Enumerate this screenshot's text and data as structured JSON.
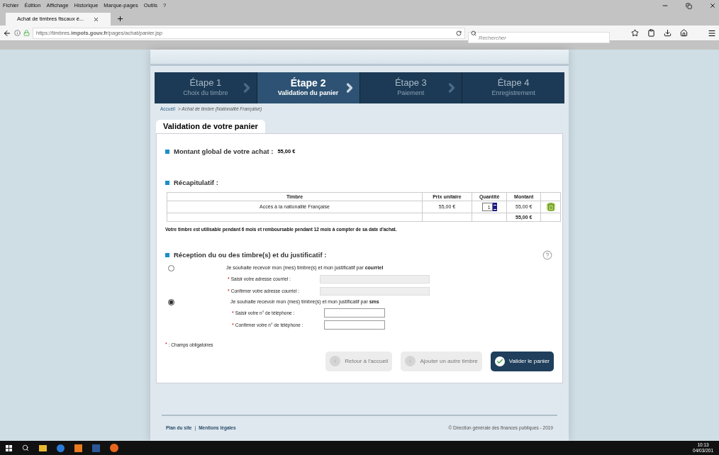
{
  "browser": {
    "menu": [
      "Fichier",
      "Édition",
      "Affichage",
      "Historique",
      "Marque-pages",
      "Outils",
      "?"
    ],
    "tab": {
      "title": "Achat de timbres fiscaux é..."
    },
    "url": "https://timbres.**impots.gouv.fr**/pages/achat/panier.jsp",
    "search": {
      "placeholder": "Rechercher"
    }
  },
  "steps": [
    {
      "title": "Étape 1",
      "subtitle": "Choix du timbre",
      "selected": false
    },
    {
      "title": "Étape 2",
      "subtitle": "Validation du panier",
      "selected": true
    },
    {
      "title": "Étape 3",
      "subtitle": "Paiement",
      "selected": false
    },
    {
      "title": "Étape 4",
      "subtitle": "Enregistrement",
      "selected": false
    }
  ],
  "breadcrumb": {
    "link": "Accueil",
    "rest": "> Achat de timbre (Nationalité Française)"
  },
  "card": {
    "title": "Validation de votre panier"
  },
  "total": {
    "label": "Montant global de votre achat :",
    "value": "55,00 €"
  },
  "recap": {
    "heading": "Récapitulatif :",
    "columns": [
      "Timbre",
      "Prix unitaire",
      "Quantité",
      "Montant"
    ],
    "rows": [
      {
        "timbre": "Accès à la nationalité Française",
        "prix": "55,00 €",
        "quantite": "1",
        "montant": "55,00 €"
      }
    ],
    "sum": "55,00 €",
    "note": "Votre timbre est utilisable pendant 6 mois et remboursable pendant 12 mois à compter de sa date d'achat."
  },
  "reception": {
    "heading": "Réception du ou des timbre(s) et du justificatif :",
    "options": [
      {
        "label": "Je souhaite recevoir mon (mes) timbre(s) et mon justificatif par **courriel**",
        "selected": false,
        "fields": [
          {
            "label": "Saisir votre adresse courriel :",
            "disabled": true
          },
          {
            "label": "Confirmer votre adresse courriel :",
            "disabled": true
          }
        ]
      },
      {
        "label": "Je souhaite recevoir mon (mes) timbre(s) et mon justificatif par **sms**",
        "selected": true,
        "fields": [
          {
            "label": "Saisir votre n° de téléphone :",
            "disabled": false
          },
          {
            "label": "Confirmer votre n° de téléphone :",
            "disabled": false
          }
        ]
      }
    ]
  },
  "required": {
    "mark": "*",
    "label": ": Champs obligatoires"
  },
  "buttons": [
    {
      "label": "Retour à l'accueil",
      "kind": "secondary"
    },
    {
      "label": "Ajouter un autre timbre",
      "kind": "secondary"
    },
    {
      "label": "Valider le panier",
      "kind": "primary"
    }
  ],
  "footer": {
    "links": [
      "Plan du site",
      "Mentions légales"
    ],
    "separator": "|",
    "copyright": "© Direction générale des finances publiques - 2019"
  },
  "taskbar": {
    "time": "10:13",
    "date": "04/03/201"
  }
}
